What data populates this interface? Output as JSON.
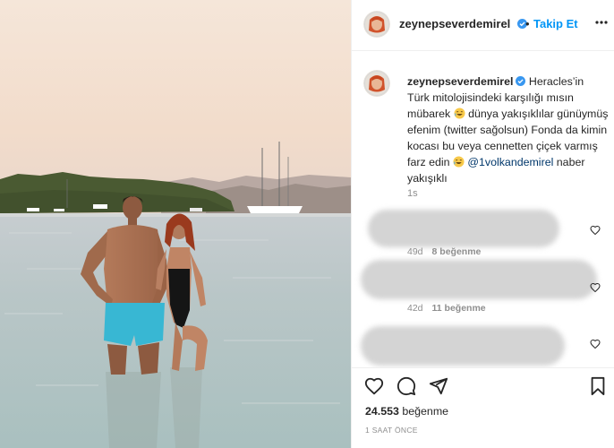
{
  "post": {
    "username": "zeynepseverdemirel",
    "dot_separator": "•",
    "follow_label": "Takip Et",
    "image_alt": "Couple standing in the sea at sunset"
  },
  "caption": {
    "username": "zeynepseverdemirel",
    "text_part1": " Heracles’in Türk mitolojisindeki karşılığı mısın mübarek ",
    "text_part2": " dünya yakışıklılar günüymüş efenim (twitter sağolsun) Fonda da kimin kocası bu veya cennetten çiçek varmış farz edin ",
    "mention": "@1volkandemirel",
    "text_part3": " naber yakışıklı",
    "time": "1s"
  },
  "comments": [
    {
      "time": "49d",
      "likes": "8 beğenme"
    },
    {
      "time": "42d",
      "likes": "11 beğenme"
    },
    {
      "time": "",
      "likes": ""
    }
  ],
  "engagement": {
    "like_count": "24.553",
    "like_label": "beğenme",
    "time_ago": "1 SAAT ÖNCE"
  },
  "colors": {
    "accent": "#0095f6",
    "verified": "#3897f0",
    "mention": "#00376b",
    "secondary_text": "#8e8e8e"
  },
  "icons": [
    "more-icon",
    "verified-icon",
    "heart-icon",
    "comment-icon",
    "share-icon",
    "bookmark-icon"
  ]
}
